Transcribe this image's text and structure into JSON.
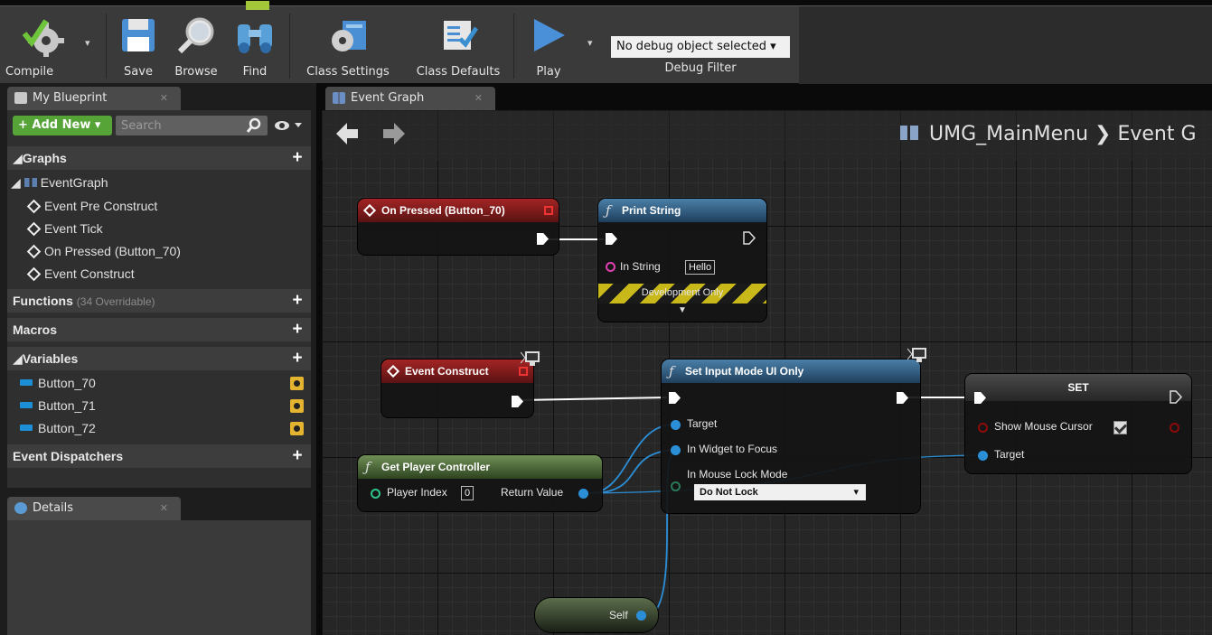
{
  "toolbar": {
    "compile": "Compile",
    "save": "Save",
    "browse": "Browse",
    "find": "Find",
    "class_settings": "Class Settings",
    "class_defaults": "Class Defaults",
    "play": "Play",
    "debug_select": "No debug object selected",
    "debug_label": "Debug Filter"
  },
  "left_panel": {
    "tab": "My Blueprint",
    "add_new": "+ Add New",
    "search_placeholder": "Search",
    "graphs_title": "Graphs",
    "eventgraph": "EventGraph",
    "events": [
      "Event Pre Construct",
      "Event Tick",
      "On Pressed (Button_70)",
      "Event Construct"
    ],
    "functions_title": "Functions",
    "functions_count": "(34 Overridable)",
    "macros_title": "Macros",
    "variables_title": "Variables",
    "variables": [
      "Button_70",
      "Button_71",
      "Button_72"
    ],
    "dispatchers_title": "Event Dispatchers",
    "details_tab": "Details"
  },
  "graph": {
    "tab": "Event Graph",
    "breadcrumb": "UMG_MainMenu ❯ Event G",
    "nodes": {
      "on_pressed": "On Pressed (Button_70)",
      "print_string": "Print String",
      "in_string": "In String",
      "in_string_value": "Hello",
      "development_only": "Development Only",
      "event_construct": "Event Construct",
      "set_input_mode": "Set Input Mode UI Only",
      "target": "Target",
      "in_widget_to_focus": "In Widget to Focus",
      "in_mouse_lock_mode": "In Mouse Lock Mode",
      "mouse_lock_value": "Do Not Lock",
      "set": "SET",
      "show_mouse_cursor": "Show Mouse Cursor",
      "set_target": "Target",
      "get_player_controller": "Get Player Controller",
      "player_index": "Player Index",
      "player_index_value": "0",
      "return_value": "Return Value",
      "self": "Self"
    }
  },
  "colors": {
    "event_header": "#a32424",
    "function_header": "#4a7fa8",
    "pure_header": "#6f8f56",
    "object_pin": "#1d8fd6",
    "string_pin": "#e040b0",
    "bool_pin": "#8c0b0b",
    "add_new": "#56a338"
  },
  "icons": [
    "compile-icon",
    "save-icon",
    "browse-icon",
    "find-icon",
    "class-settings-icon",
    "class-defaults-icon",
    "play-icon",
    "search-icon",
    "eye-icon",
    "plus-icon",
    "event-icon",
    "function-icon",
    "network-icon"
  ]
}
